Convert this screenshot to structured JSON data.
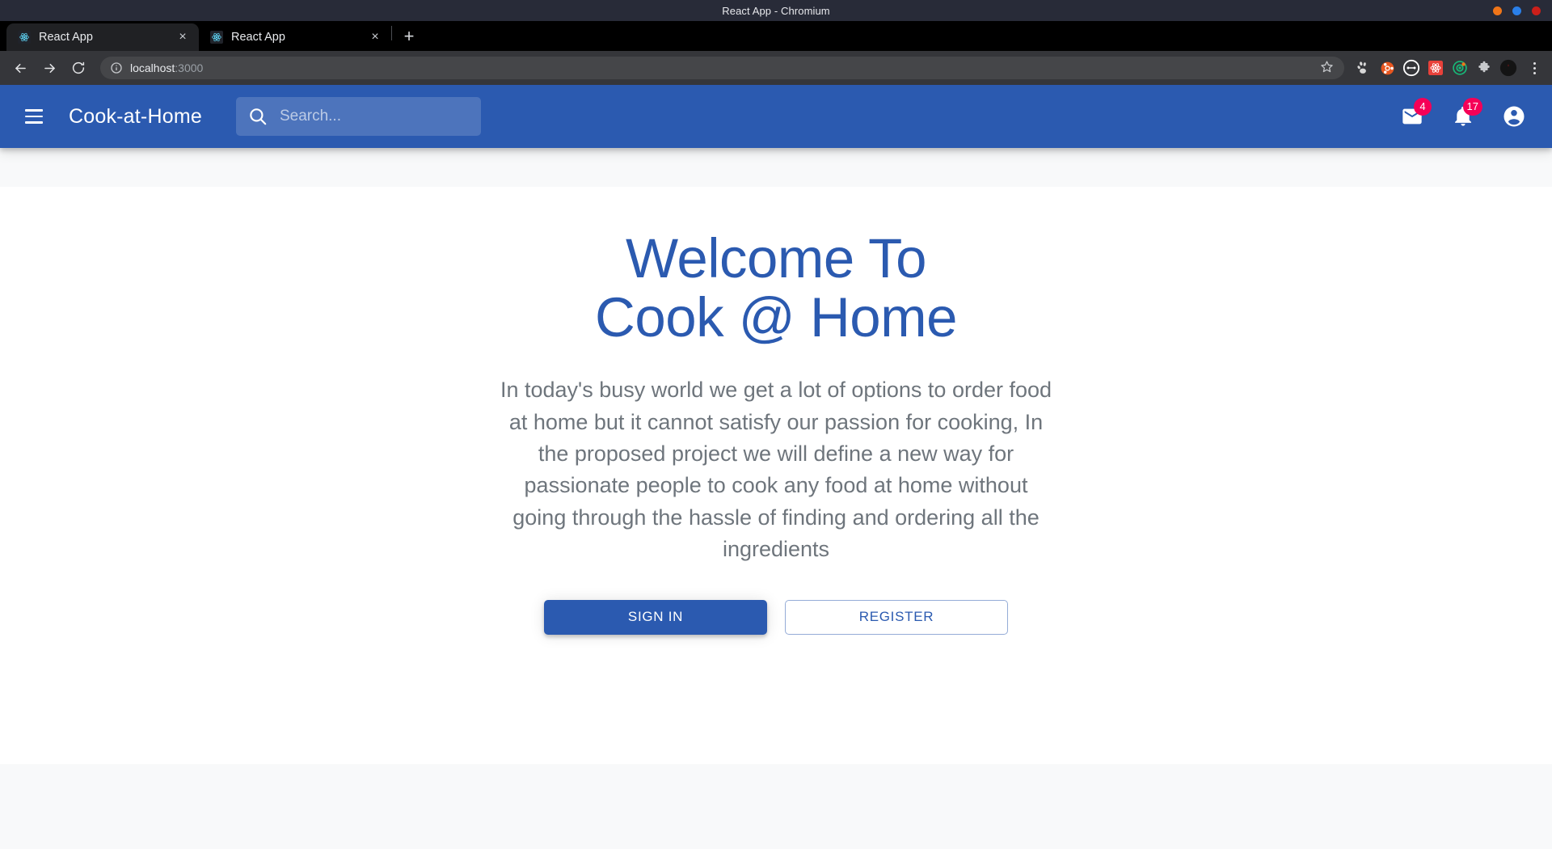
{
  "window": {
    "title": "React App - Chromium",
    "controls": [
      {
        "name": "minimize",
        "color": "#f07518"
      },
      {
        "name": "maximize",
        "color": "#2a7fe8"
      },
      {
        "name": "close",
        "color": "#cc1f1a"
      }
    ]
  },
  "browser": {
    "tabs": [
      {
        "title": "React App",
        "favicon": "react-icon",
        "active": true,
        "close_label": "×"
      },
      {
        "title": "React App",
        "favicon": "react-icon",
        "active": false,
        "close_label": "×"
      }
    ],
    "new_tab_label": "+",
    "nav": {
      "back_label": "←",
      "forward_label": "→",
      "reload_label": "⟳"
    },
    "omnibox": {
      "host": "localhost",
      "port": ":3000",
      "info_icon": "site-info-icon",
      "bookmark_icon": "star-icon"
    },
    "extensions": [
      {
        "name": "gnome-extension-icon",
        "color": "#d8d8d8"
      },
      {
        "name": "ubuntu-extension-icon",
        "color": "#e8561f"
      },
      {
        "name": "loom-extension-icon",
        "color": "#ffffff"
      },
      {
        "name": "react-devtools-extension-icon",
        "color": "#e8413a"
      },
      {
        "name": "target-extension-icon",
        "color": "#17b978"
      },
      {
        "name": "puzzle-extensions-icon",
        "color": "#c7c9cc"
      },
      {
        "name": "profile-avatar-icon",
        "color": "#141414"
      }
    ],
    "menu_label": "chrome-menu-icon"
  },
  "app": {
    "brand": "Cook-at-Home",
    "menu_icon": "hamburger-menu-icon",
    "search": {
      "placeholder": "Search...",
      "value": "",
      "icon": "search-icon"
    },
    "actions": [
      {
        "name": "mail-icon",
        "badge": "4"
      },
      {
        "name": "notifications-bell-icon",
        "badge": "17"
      },
      {
        "name": "account-circle-icon",
        "badge": ""
      }
    ],
    "badge_color": "#f50057",
    "primary_color": "#2B5AB0"
  },
  "hero": {
    "heading_line1": "Welcome To",
    "heading_line2": "Cook @ Home",
    "body": "In today's busy world we get a lot of options to order food at home but it cannot satisfy our passion for cooking, In the proposed project we will define a new way for passionate people to cook any food at home without going through the hassle of finding and ordering all the ingredients",
    "sign_in_label": "SIGN IN",
    "register_label": "REGISTER"
  }
}
